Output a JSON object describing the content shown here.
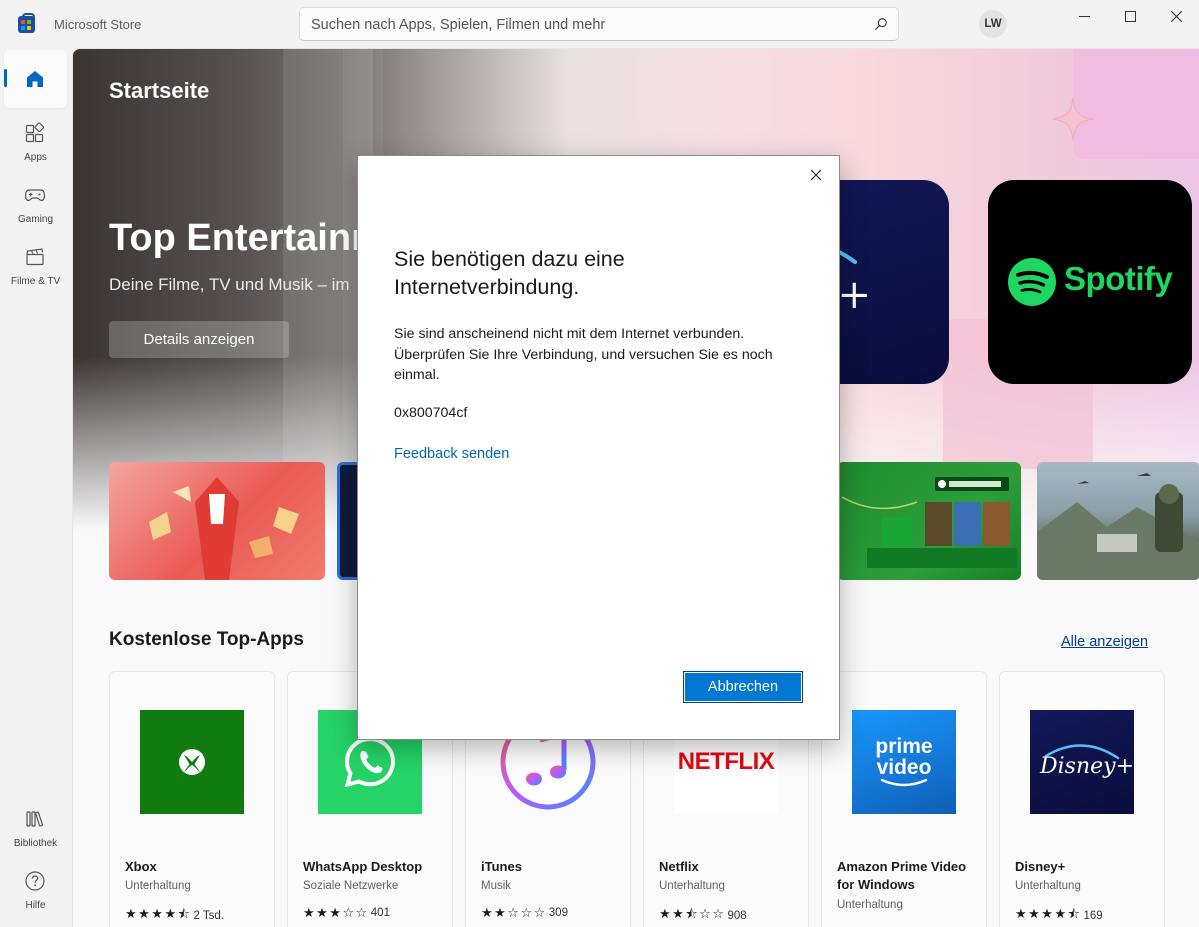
{
  "window": {
    "app_title": "Microsoft Store",
    "search_placeholder": "Suchen nach Apps, Spielen, Filmen und mehr",
    "avatar_initials": "LW"
  },
  "sidebar": {
    "items": [
      {
        "id": "home",
        "label": "",
        "icon": "home-icon",
        "active": true
      },
      {
        "id": "apps",
        "label": "Apps",
        "icon": "apps-grid-icon"
      },
      {
        "id": "gaming",
        "label": "Gaming",
        "icon": "gamepad-icon"
      },
      {
        "id": "movies",
        "label": "Filme & TV",
        "icon": "clapperboard-icon"
      }
    ],
    "bottom": [
      {
        "id": "library",
        "label": "Bibliothek",
        "icon": "library-icon"
      },
      {
        "id": "help",
        "label": "Hilfe",
        "icon": "help-icon"
      }
    ]
  },
  "hero": {
    "page_title": "Startseite",
    "title": "Top Entertainm",
    "subtitle": "Deine Filme, TV und Musik – im",
    "button": "Details anzeigen",
    "spotify_brand": "Spotify"
  },
  "section": {
    "title": "Kostenlose Top-Apps",
    "see_all": "Alle anzeigen"
  },
  "apps": [
    {
      "name": "Xbox",
      "category": "Unterhaltung",
      "stars": "★★★★⯪",
      "rating_count": "2 Tsd.",
      "color": "#107c10"
    },
    {
      "name": "WhatsApp Desktop",
      "category": "Soziale Netzwerke",
      "stars": "★★★☆☆",
      "rating_count": "401",
      "color": "#25d366"
    },
    {
      "name": "iTunes",
      "category": "Musik",
      "stars": "★★☆☆☆",
      "rating_count": "309",
      "color": "#fc5c7d"
    },
    {
      "name": "Netflix",
      "category": "Unterhaltung",
      "stars": "★★⯪☆☆",
      "rating_count": "908",
      "color": "#e50914"
    },
    {
      "name": "Amazon Prime Video for Windows",
      "category": "Unterhaltung",
      "stars": "",
      "rating_count": "",
      "color": "#1a98ff"
    },
    {
      "name": "Disney+",
      "category": "Unterhaltung",
      "stars": "★★★★⯪",
      "rating_count": "169",
      "color": "#0e1655"
    }
  ],
  "app_icon_text": {
    "netflix": "NETFLIX",
    "prime_line1": "prime",
    "prime_line2": "video",
    "disney": "Disney+"
  },
  "dialog": {
    "title": "Sie benötigen dazu eine Internetverbindung.",
    "body": "Sie sind anscheinend nicht mit dem Internet verbunden. Überprüfen Sie Ihre Verbindung, und versuchen Sie es noch einmal.",
    "error_code": "0x800704cf",
    "feedback_link": "Feedback senden",
    "cancel_button": "Abbrechen"
  }
}
